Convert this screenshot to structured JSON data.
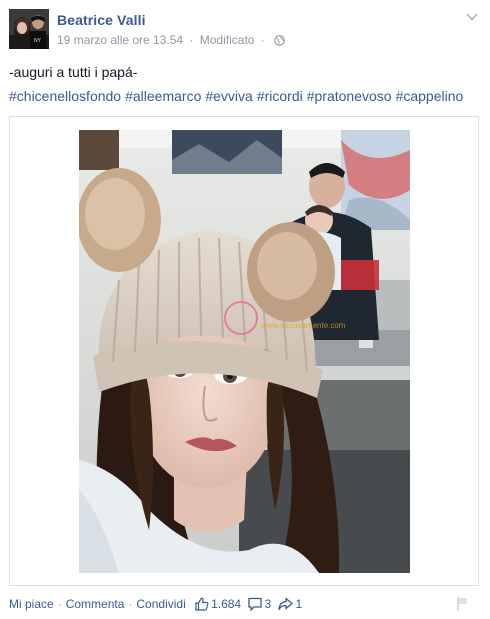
{
  "post": {
    "author": "Beatrice Valli",
    "date": "19 marzo alle ore 13.54",
    "edited": "Modificato",
    "meta_sep": "·",
    "text": "-auguri a tutti i papá-",
    "hashtags": [
      "#chicenellosfondo",
      "#alleemarco",
      "#evviva",
      "#ricordi",
      "#pratonevoso",
      "#cappelino"
    ],
    "watermark": "www.seriosamente.com"
  },
  "icons": {
    "avatar": "profile-photo",
    "audience": "globe-icon",
    "menu": "chevron-down-icon",
    "like": "thumbs-up-icon",
    "comment": "comment-bubble-icon",
    "share": "share-arrow-icon",
    "report": "flag-icon"
  },
  "footer": {
    "like": "Mi piace",
    "comment": "Commenta",
    "share": "Condividi",
    "sep": "·",
    "likes_count": "1.684",
    "comments_count": "3",
    "shares_count": "1"
  },
  "colors": {
    "link": "#3b5998",
    "meta": "#9197a3",
    "text": "#141823",
    "border": "#dddfe2"
  }
}
